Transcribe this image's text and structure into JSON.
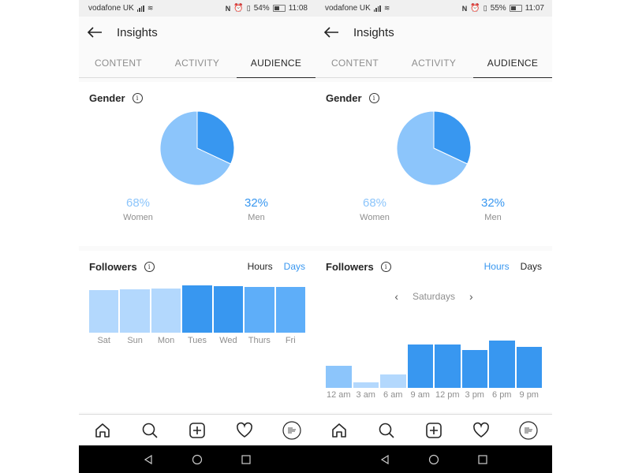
{
  "screens": [
    {
      "status": {
        "carrier": "vodafone UK",
        "battery": "54%",
        "time": "11:08"
      },
      "header": {
        "title": "Insights"
      },
      "tabs": [
        {
          "label": "CONTENT"
        },
        {
          "label": "ACTIVITY"
        },
        {
          "label": "AUDIENCE",
          "active": true
        }
      ],
      "gender": {
        "title": "Gender",
        "women_pct": "68%",
        "women_label": "Women",
        "men_pct": "32%",
        "men_label": "Men"
      },
      "followers": {
        "title": "Followers",
        "toggle": {
          "hours": "Hours",
          "days": "Days",
          "selected": "Days"
        }
      }
    },
    {
      "status": {
        "carrier": "vodafone UK",
        "battery": "55%",
        "time": "11:07"
      },
      "header": {
        "title": "Insights"
      },
      "tabs": [
        {
          "label": "CONTENT"
        },
        {
          "label": "ACTIVITY"
        },
        {
          "label": "AUDIENCE",
          "active": true
        }
      ],
      "gender": {
        "title": "Gender",
        "women_pct": "68%",
        "women_label": "Women",
        "men_pct": "32%",
        "men_label": "Men"
      },
      "followers": {
        "title": "Followers",
        "toggle": {
          "hours": "Hours",
          "days": "Days",
          "selected": "Hours"
        },
        "day_selector": "Saturdays"
      }
    }
  ],
  "colors": {
    "dark": "#3897f0",
    "medium": "#5eaef9",
    "light": "#b3d8fd",
    "lighter": "#8cc5fb",
    "accent": "#3897f0"
  },
  "bottom_nav": [
    "home-icon",
    "search-icon",
    "new-post-icon",
    "activity-heart-icon",
    "profile-avatar"
  ],
  "chart_data": [
    {
      "type": "pie",
      "title": "Gender",
      "categories": [
        "Women",
        "Men"
      ],
      "values": [
        68,
        32
      ]
    },
    {
      "type": "bar",
      "title": "Followers (Days)",
      "categories": [
        "Sat",
        "Sun",
        "Mon",
        "Tues",
        "Wed",
        "Thurs",
        "Fri"
      ],
      "values": [
        90,
        92,
        93,
        100,
        98,
        96,
        97
      ],
      "shade": [
        "light",
        "light",
        "light",
        "dark",
        "dark",
        "medium",
        "medium"
      ]
    },
    {
      "type": "bar",
      "title": "Followers (Hours) - Saturdays",
      "categories": [
        "12 am",
        "3 am",
        "6 am",
        "9 am",
        "12 pm",
        "3 pm",
        "6 pm",
        "9 pm"
      ],
      "values": [
        45,
        12,
        27,
        90,
        90,
        78,
        98,
        85
      ],
      "shade": [
        "lighter",
        "light",
        "light",
        "dark",
        "dark",
        "dark",
        "dark",
        "dark"
      ]
    }
  ]
}
